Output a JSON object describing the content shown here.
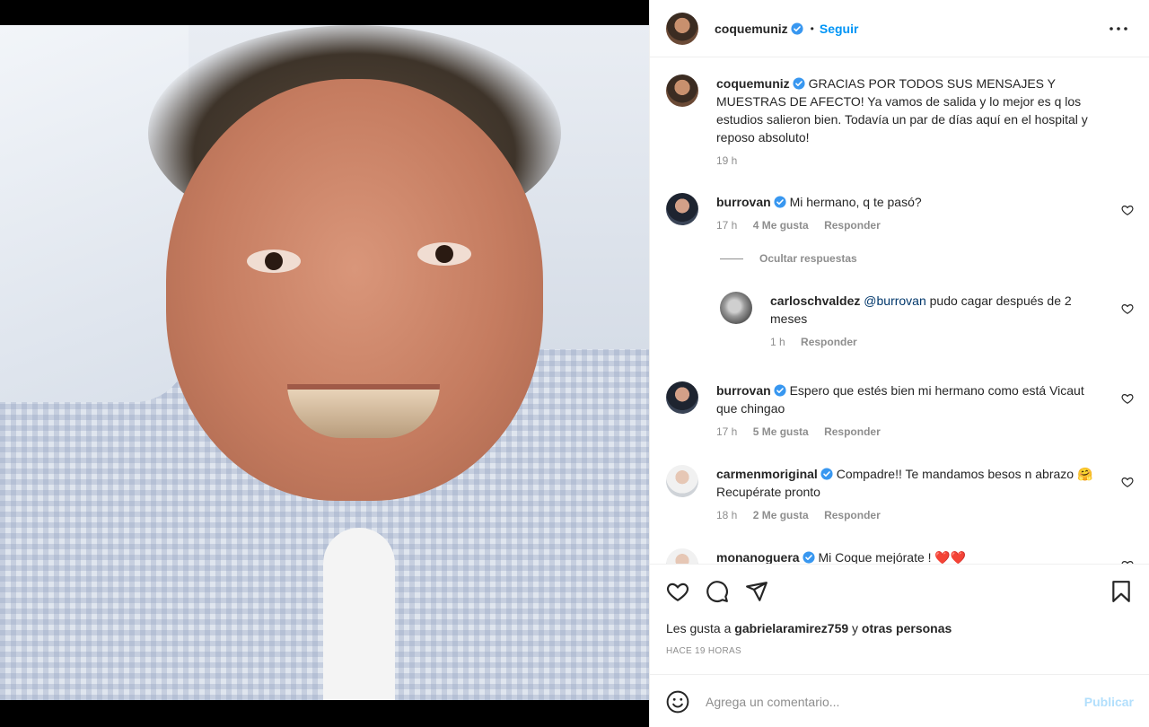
{
  "post": {
    "author": "coquemuniz",
    "follow_label": "Seguir",
    "separator": "•",
    "caption": "GRACIAS POR TODOS SUS MENSAJES Y MUESTRAS DE AFECTO! Ya vamos de salida y lo mejor es q los estudios salieron bien. Todavía un par de días aquí en el hospital y reposo absoluto!",
    "caption_time": "19 h"
  },
  "comments": [
    {
      "user": "burrovan",
      "text": "Mi hermano, q te pasó?",
      "time": "17 h",
      "likes": "4 Me gusta",
      "reply": "Responder"
    },
    {
      "user": "burrovan",
      "text": "Espero que estés bien mi hermano como está Vicaut que chingao",
      "time": "17 h",
      "likes": "5 Me gusta",
      "reply": "Responder"
    },
    {
      "user": "carmenmoriginal",
      "text": "Compadre!! Te mandamos besos n abrazo 🤗 Recupérate pronto",
      "time": "18 h",
      "likes": "2 Me gusta",
      "reply": "Responder"
    },
    {
      "user": "monanoguera",
      "text": "Mi Coque mejórate ! ❤️❤️"
    }
  ],
  "hide_replies_label": "Ocultar respuestas",
  "reply": {
    "user": "carloschvaldez",
    "mention": "@burrovan",
    "text": " pudo cagar después de 2 meses",
    "time": "1 h",
    "reply": "Responder"
  },
  "likes_line": {
    "prefix": "Les gusta a ",
    "user": "gabrielaramirez759",
    "middle": " y ",
    "others": "otras personas"
  },
  "time_ago": "HACE 19 HORAS",
  "add_comment": {
    "placeholder": "Agrega un comentario...",
    "publish": "Publicar"
  },
  "colors": {
    "accent": "#0095f6",
    "publish_disabled": "#b2dffc",
    "verified": "#3897f0",
    "like_red": "#ed4956"
  },
  "icons": [
    "more-icon",
    "verified-icon",
    "heart-icon",
    "comment-icon",
    "share-icon",
    "bookmark-icon",
    "emoji-icon"
  ]
}
